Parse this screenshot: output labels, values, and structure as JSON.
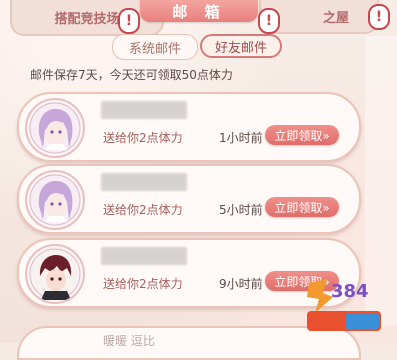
{
  "header": {
    "title": "邮 箱",
    "left_banner": "搭配竞技场",
    "right_banner": "之屋"
  },
  "tabs": [
    {
      "label": "系统邮件",
      "active": false
    },
    {
      "label": "好友邮件",
      "active": true
    }
  ],
  "notice": "邮件保存7天，今天还可领取50点体力",
  "mails": [
    {
      "gift": "送给你2点体力",
      "time": "1小时前",
      "claim": "立即领取»"
    },
    {
      "gift": "送给你2点体力",
      "time": "5小时前",
      "claim": "立即领取»"
    },
    {
      "gift": "送给你2点体力",
      "time": "9小时前",
      "claim": "立即领取»"
    }
  ],
  "partial_mail_name": "暖暖 逗比",
  "colors": {
    "accent": "#e06d6a",
    "card_border": "#ecc3b7",
    "background": "#f6ebe4"
  }
}
